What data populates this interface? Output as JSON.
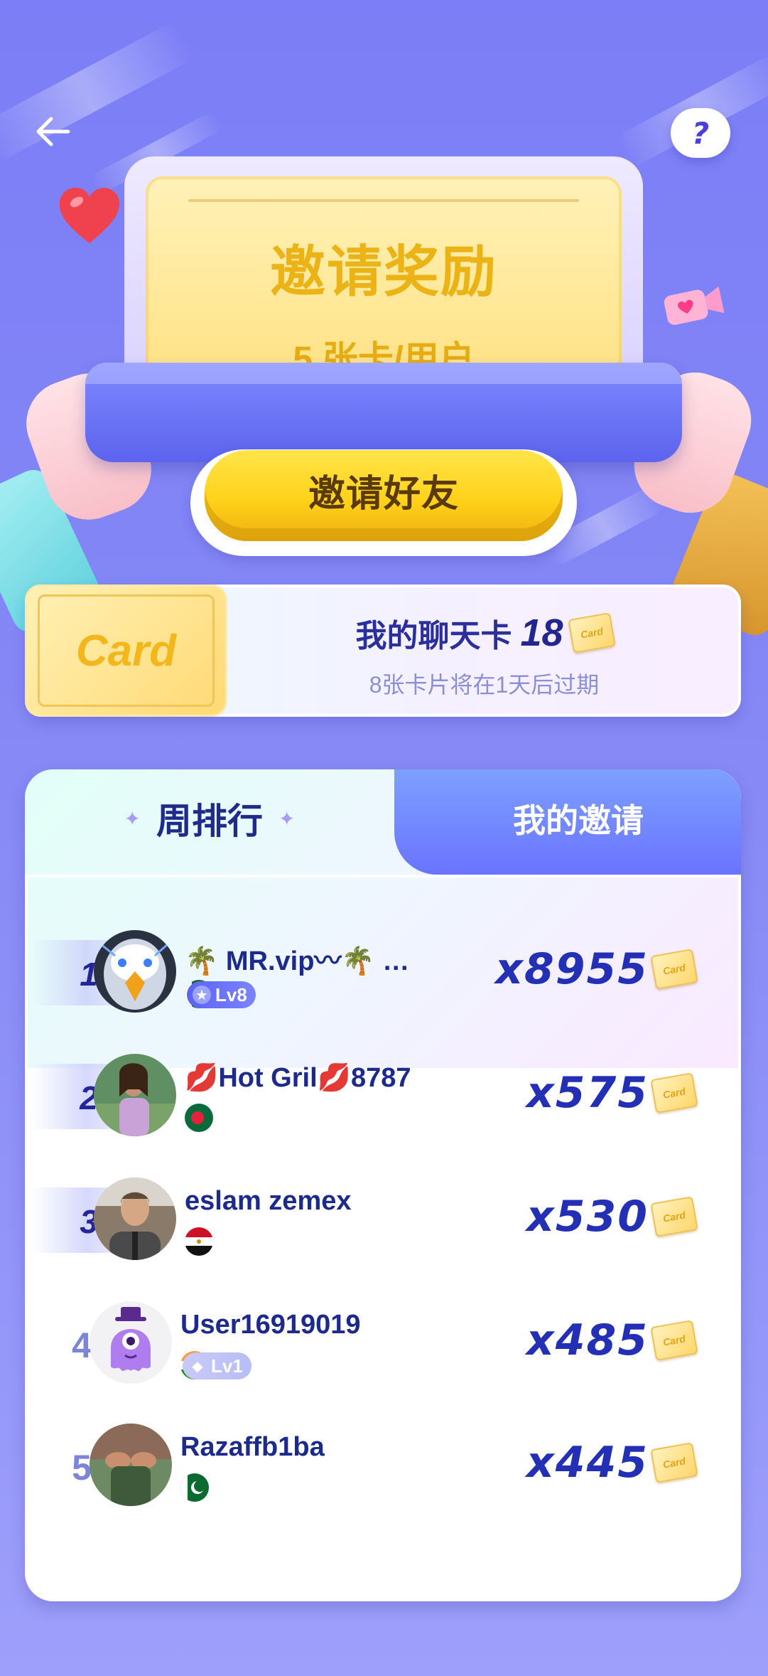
{
  "header": {
    "back_icon": "arrow-left-icon",
    "help_icon": "question-mark-icon",
    "help_label": "?"
  },
  "banner": {
    "title": "邀请奖励",
    "subtitle": "5 张卡/用户"
  },
  "invite_button": {
    "label": "邀请好友"
  },
  "card_summary": {
    "tile_label": "Card",
    "title": "我的聊天卡",
    "count": "18",
    "expiry_note": "8张卡片将在1天后过期",
    "card_icon_label": "Card"
  },
  "tabs": {
    "weekly": "周排行",
    "my_invites": "我的邀请",
    "active": "weekly"
  },
  "ranking": [
    {
      "rank": "1",
      "name": "🌴 MR.vip〰🌴 …",
      "flag": "pakistan",
      "level": "Lv8",
      "level_tier": "star",
      "score": "x8955"
    },
    {
      "rank": "2",
      "name": "💋Hot Gril💋8787",
      "flag": "bangladesh",
      "level": "",
      "score": "x575"
    },
    {
      "rank": "3",
      "name": "eslam zemex",
      "flag": "egypt",
      "level": "",
      "score": "x530"
    },
    {
      "rank": "4",
      "name": "User16919019",
      "flag": "india",
      "level": "Lv1",
      "level_tier": "diamond",
      "score": "x485"
    },
    {
      "rank": "5",
      "name": "Razaffb1ba",
      "flag": "pakistan",
      "level": "",
      "score": "x445"
    }
  ],
  "colors": {
    "background": "#7b7ef6",
    "gold_title": "#ebb315",
    "rank_text": "#24259a",
    "score_text": "#2330b6",
    "tab_active_text": "#1f2a8a"
  }
}
